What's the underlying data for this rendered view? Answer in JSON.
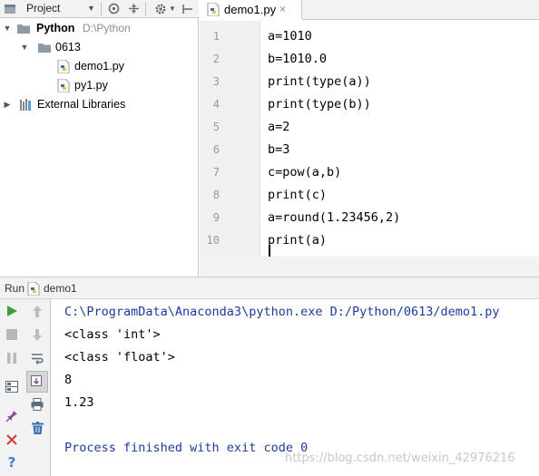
{
  "project_panel": {
    "toolbar_label": "Project",
    "tree": {
      "root": {
        "name": "Python",
        "path": "D:\\Python"
      },
      "folder": {
        "name": "0613"
      },
      "files": [
        "demo1.py",
        "py1.py"
      ],
      "external": "External Libraries"
    }
  },
  "editor": {
    "tab_label": "demo1.py",
    "tab_close": "×",
    "lines": [
      {
        "num": "1",
        "code": "a=1010"
      },
      {
        "num": "2",
        "code": "b=1010.0"
      },
      {
        "num": "3",
        "code": "print(type(a))"
      },
      {
        "num": "4",
        "code": "print(type(b))"
      },
      {
        "num": "5",
        "code": "a=2"
      },
      {
        "num": "6",
        "code": "b=3"
      },
      {
        "num": "7",
        "code": "c=pow(a,b)"
      },
      {
        "num": "8",
        "code": "print(c)"
      },
      {
        "num": "9",
        "code": "a=round(1.23456,2)"
      },
      {
        "num": "10",
        "code": "print(a)"
      }
    ]
  },
  "run_panel": {
    "label": "Run",
    "config": "demo1",
    "output": [
      "C:\\ProgramData\\Anaconda3\\python.exe D:/Python/0613/demo1.py",
      "<class 'int'>",
      "<class 'float'>",
      "8",
      "1.23",
      "",
      "Process finished with exit code 0"
    ]
  },
  "watermark": "https://blog.csdn.net/weixin_42976216",
  "icons": {
    "run": "run-icon",
    "stop": "stop-icon",
    "pause": "pause-icon",
    "up": "arrow-up-icon",
    "down": "arrow-down-icon",
    "trash": "trash-icon",
    "close": "close-icon",
    "help": "help-icon",
    "settings": "gear-icon"
  },
  "colors": {
    "run_green": "#3d9e3d",
    "stop_red": "#d13b3b",
    "exit_text_blue": "#1f3a9c",
    "help_blue": "#3a7fd5"
  }
}
